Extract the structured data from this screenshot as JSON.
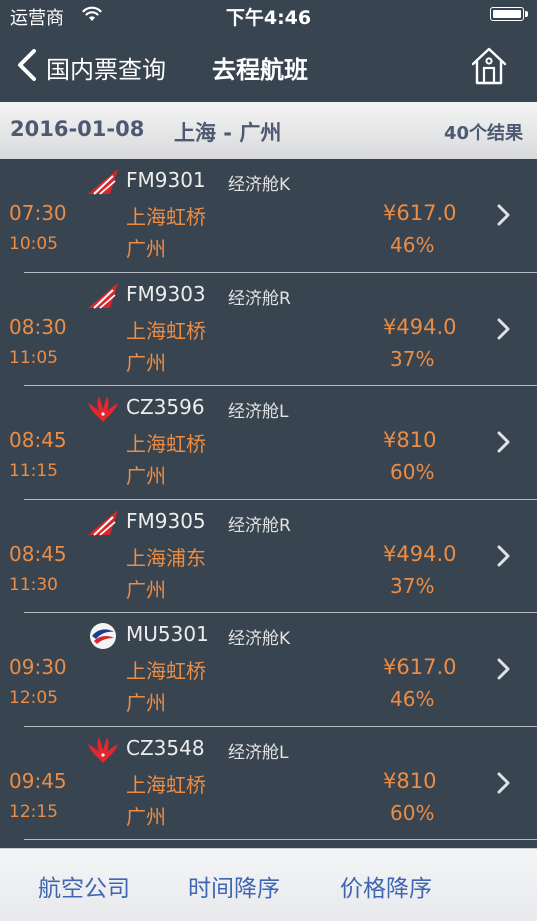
{
  "status_bar": {
    "carrier": "运营商",
    "time": "下午4:46"
  },
  "nav": {
    "back_label": "国内票查询",
    "title": "去程航班"
  },
  "subheader": {
    "date": "2016-01-08",
    "route": "上海 - 广州",
    "count": "40个结果"
  },
  "flights": [
    {
      "airline_icon": "shanghai-airlines-logo",
      "flight_no": "FM9301",
      "cabin": "经济舱K",
      "dep_time": "07:30",
      "arr_time": "10:05",
      "dep_airport": "上海虹桥",
      "arr_airport": "广州",
      "price": "¥617.0",
      "discount": "46%"
    },
    {
      "airline_icon": "shanghai-airlines-logo",
      "flight_no": "FM9303",
      "cabin": "经济舱R",
      "dep_time": "08:30",
      "arr_time": "11:05",
      "dep_airport": "上海虹桥",
      "arr_airport": "广州",
      "price": "¥494.0",
      "discount": "37%"
    },
    {
      "airline_icon": "china-southern-logo",
      "flight_no": "CZ3596",
      "cabin": "经济舱L",
      "dep_time": "08:45",
      "arr_time": "11:15",
      "dep_airport": "上海虹桥",
      "arr_airport": "广州",
      "price": "¥810",
      "discount": "60%"
    },
    {
      "airline_icon": "shanghai-airlines-logo",
      "flight_no": "FM9305",
      "cabin": "经济舱R",
      "dep_time": "08:45",
      "arr_time": "11:30",
      "dep_airport": "上海浦东",
      "arr_airport": "广州",
      "price": "¥494.0",
      "discount": "37%"
    },
    {
      "airline_icon": "china-eastern-logo",
      "flight_no": "MU5301",
      "cabin": "经济舱K",
      "dep_time": "09:30",
      "arr_time": "12:05",
      "dep_airport": "上海虹桥",
      "arr_airport": "广州",
      "price": "¥617.0",
      "discount": "46%"
    },
    {
      "airline_icon": "china-southern-logo",
      "flight_no": "CZ3548",
      "cabin": "经济舱L",
      "dep_time": "09:45",
      "arr_time": "12:15",
      "dep_airport": "上海虹桥",
      "arr_airport": "广州",
      "price": "¥810",
      "discount": "60%"
    }
  ],
  "toolbar": {
    "airline_label": "航空公司",
    "time_sort_label": "时间降序",
    "price_sort_label": "价格降序"
  },
  "colors": {
    "background": "#38444f",
    "accent_orange": "#ec8c45",
    "toolbar_blue": "#3f66b3",
    "subheader_text": "#4d5a72"
  }
}
